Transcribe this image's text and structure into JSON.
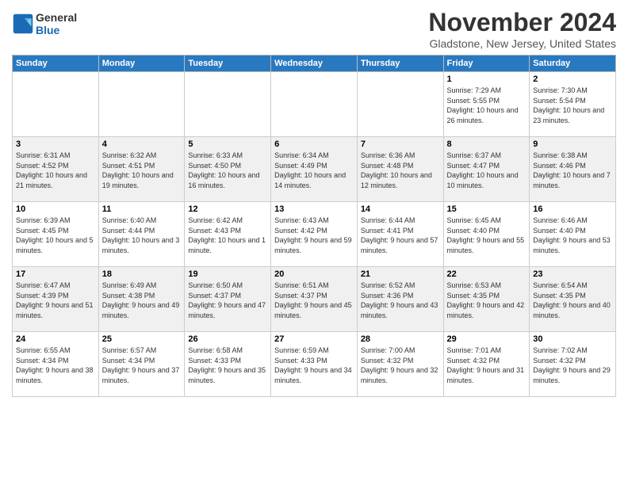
{
  "logo": {
    "line1": "General",
    "line2": "Blue"
  },
  "header": {
    "title": "November 2024",
    "subtitle": "Gladstone, New Jersey, United States"
  },
  "weekdays": [
    "Sunday",
    "Monday",
    "Tuesday",
    "Wednesday",
    "Thursday",
    "Friday",
    "Saturday"
  ],
  "weeks": [
    [
      {
        "day": "",
        "info": ""
      },
      {
        "day": "",
        "info": ""
      },
      {
        "day": "",
        "info": ""
      },
      {
        "day": "",
        "info": ""
      },
      {
        "day": "",
        "info": ""
      },
      {
        "day": "1",
        "info": "Sunrise: 7:29 AM\nSunset: 5:55 PM\nDaylight: 10 hours and 26 minutes."
      },
      {
        "day": "2",
        "info": "Sunrise: 7:30 AM\nSunset: 5:54 PM\nDaylight: 10 hours and 23 minutes."
      }
    ],
    [
      {
        "day": "3",
        "info": "Sunrise: 6:31 AM\nSunset: 4:52 PM\nDaylight: 10 hours and 21 minutes."
      },
      {
        "day": "4",
        "info": "Sunrise: 6:32 AM\nSunset: 4:51 PM\nDaylight: 10 hours and 19 minutes."
      },
      {
        "day": "5",
        "info": "Sunrise: 6:33 AM\nSunset: 4:50 PM\nDaylight: 10 hours and 16 minutes."
      },
      {
        "day": "6",
        "info": "Sunrise: 6:34 AM\nSunset: 4:49 PM\nDaylight: 10 hours and 14 minutes."
      },
      {
        "day": "7",
        "info": "Sunrise: 6:36 AM\nSunset: 4:48 PM\nDaylight: 10 hours and 12 minutes."
      },
      {
        "day": "8",
        "info": "Sunrise: 6:37 AM\nSunset: 4:47 PM\nDaylight: 10 hours and 10 minutes."
      },
      {
        "day": "9",
        "info": "Sunrise: 6:38 AM\nSunset: 4:46 PM\nDaylight: 10 hours and 7 minutes."
      }
    ],
    [
      {
        "day": "10",
        "info": "Sunrise: 6:39 AM\nSunset: 4:45 PM\nDaylight: 10 hours and 5 minutes."
      },
      {
        "day": "11",
        "info": "Sunrise: 6:40 AM\nSunset: 4:44 PM\nDaylight: 10 hours and 3 minutes."
      },
      {
        "day": "12",
        "info": "Sunrise: 6:42 AM\nSunset: 4:43 PM\nDaylight: 10 hours and 1 minute."
      },
      {
        "day": "13",
        "info": "Sunrise: 6:43 AM\nSunset: 4:42 PM\nDaylight: 9 hours and 59 minutes."
      },
      {
        "day": "14",
        "info": "Sunrise: 6:44 AM\nSunset: 4:41 PM\nDaylight: 9 hours and 57 minutes."
      },
      {
        "day": "15",
        "info": "Sunrise: 6:45 AM\nSunset: 4:40 PM\nDaylight: 9 hours and 55 minutes."
      },
      {
        "day": "16",
        "info": "Sunrise: 6:46 AM\nSunset: 4:40 PM\nDaylight: 9 hours and 53 minutes."
      }
    ],
    [
      {
        "day": "17",
        "info": "Sunrise: 6:47 AM\nSunset: 4:39 PM\nDaylight: 9 hours and 51 minutes."
      },
      {
        "day": "18",
        "info": "Sunrise: 6:49 AM\nSunset: 4:38 PM\nDaylight: 9 hours and 49 minutes."
      },
      {
        "day": "19",
        "info": "Sunrise: 6:50 AM\nSunset: 4:37 PM\nDaylight: 9 hours and 47 minutes."
      },
      {
        "day": "20",
        "info": "Sunrise: 6:51 AM\nSunset: 4:37 PM\nDaylight: 9 hours and 45 minutes."
      },
      {
        "day": "21",
        "info": "Sunrise: 6:52 AM\nSunset: 4:36 PM\nDaylight: 9 hours and 43 minutes."
      },
      {
        "day": "22",
        "info": "Sunrise: 6:53 AM\nSunset: 4:35 PM\nDaylight: 9 hours and 42 minutes."
      },
      {
        "day": "23",
        "info": "Sunrise: 6:54 AM\nSunset: 4:35 PM\nDaylight: 9 hours and 40 minutes."
      }
    ],
    [
      {
        "day": "24",
        "info": "Sunrise: 6:55 AM\nSunset: 4:34 PM\nDaylight: 9 hours and 38 minutes."
      },
      {
        "day": "25",
        "info": "Sunrise: 6:57 AM\nSunset: 4:34 PM\nDaylight: 9 hours and 37 minutes."
      },
      {
        "day": "26",
        "info": "Sunrise: 6:58 AM\nSunset: 4:33 PM\nDaylight: 9 hours and 35 minutes."
      },
      {
        "day": "27",
        "info": "Sunrise: 6:59 AM\nSunset: 4:33 PM\nDaylight: 9 hours and 34 minutes."
      },
      {
        "day": "28",
        "info": "Sunrise: 7:00 AM\nSunset: 4:32 PM\nDaylight: 9 hours and 32 minutes."
      },
      {
        "day": "29",
        "info": "Sunrise: 7:01 AM\nSunset: 4:32 PM\nDaylight: 9 hours and 31 minutes."
      },
      {
        "day": "30",
        "info": "Sunrise: 7:02 AM\nSunset: 4:32 PM\nDaylight: 9 hours and 29 minutes."
      }
    ]
  ]
}
